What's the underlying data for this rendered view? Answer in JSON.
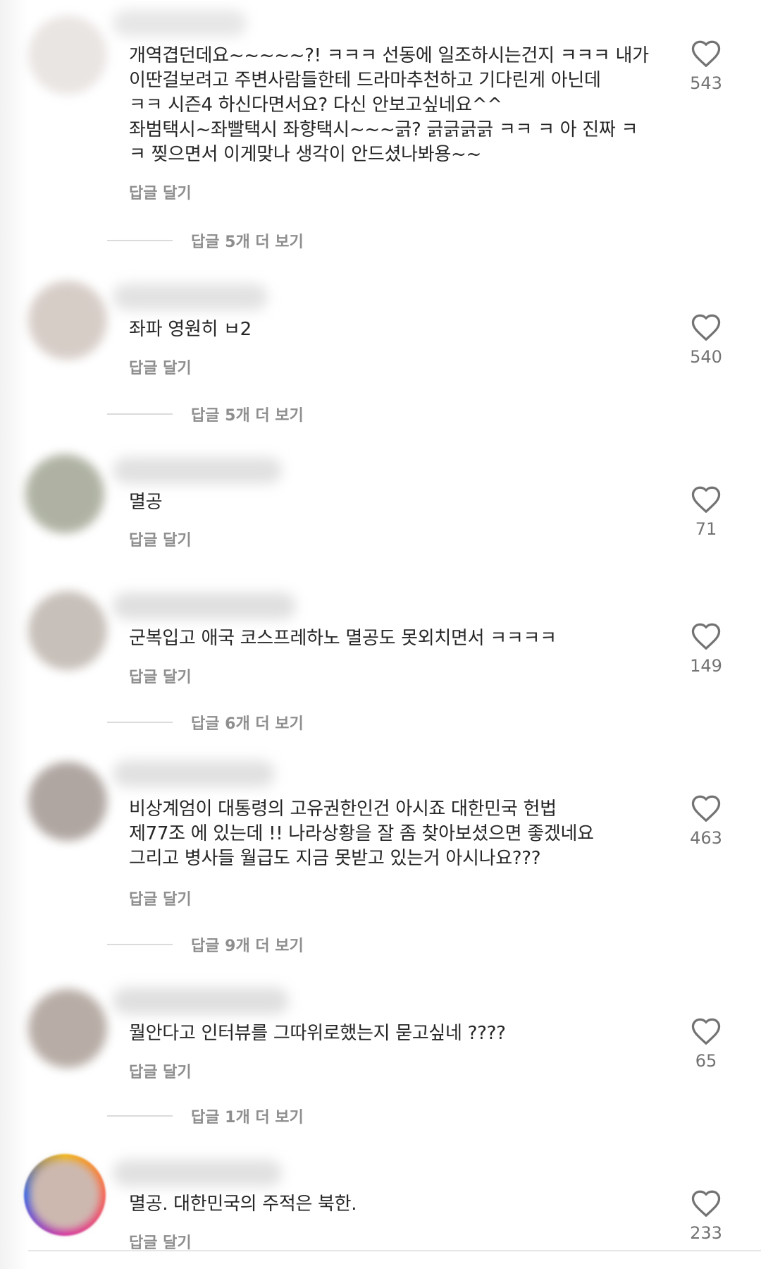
{
  "reply_label": "답글 달기",
  "comments": [
    {
      "text": "개역겹던데요~~~~~?! ㅋㅋㅋ 선동에 일조하시는건지 ㅋㅋㅋ 내가\n이딴걸보려고 주변사람들한테 드라마추천하고 기다린게 아닌데\nㅋㅋ 시즌4 하신다면서요? 다신 안보고싶네요^^\n좌범택시~좌빨택시 좌향택시~~~긁? 긁긁긁긁 ㅋㅋ ㅋ 아 진짜 ㅋ\nㅋ 찢으면서 이게맞나 생각이 안드셨나봐용~~",
      "likes": "543",
      "view_replies": "답글 5개 더 보기"
    },
    {
      "text": "좌파 영원히 ㅂ2",
      "likes": "540",
      "view_replies": "답글 5개 더 보기"
    },
    {
      "text": "멸공",
      "likes": "71",
      "view_replies": ""
    },
    {
      "text": "군복입고 애국 코스프레하노 멸공도 못외치면서 ㅋㅋㅋㅋ",
      "likes": "149",
      "view_replies": "답글 6개 더 보기"
    },
    {
      "text": "비상계엄이 대통령의 고유권한인건 아시죠 대한민국 헌법\n제77조 에 있는데 !! 나라상황을 잘 좀 찾아보셨으면 좋겠네요\n그리고 병사들 월급도 지금 못받고 있는거 아시나요???",
      "likes": "463",
      "view_replies": "답글 9개 더 보기"
    },
    {
      "text": "뭘안다고 인터뷰를 그따위로했는지 묻고싶네 ????",
      "likes": "65",
      "view_replies": "답글 1개 더 보기"
    },
    {
      "text": "멸공. 대한민국의 주적은 북한.",
      "likes": "233",
      "view_replies": ""
    }
  ],
  "colors": {
    "text": "#262626",
    "secondary": "#8e8e8e",
    "like_count": "#737373",
    "divider": "#dbdbdb"
  },
  "icons": {
    "like": "heart-outline-icon"
  }
}
